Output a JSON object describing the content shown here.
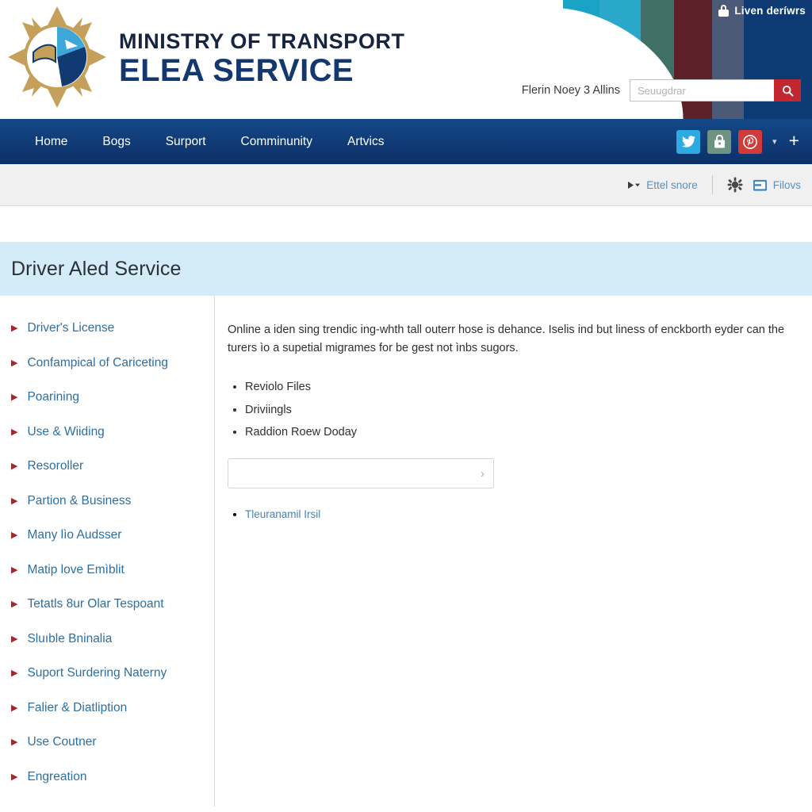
{
  "header": {
    "logo": {
      "crest_icon": "ministry-crest-starburst-icon",
      "line1": "MINISTRY OF TRANSPORT",
      "line2": "ELEA SERVICE"
    },
    "secure_badge": {
      "icon": "lock-icon",
      "text": "Liven deríwrs"
    },
    "search": {
      "label": "Flerin Noey 3 Allins",
      "placeholder": "Seuugdrar",
      "value": "",
      "button_icon": "search-icon",
      "button_color": "#c1272d"
    },
    "arc_band_colors": [
      "#1aa3c4",
      "#2a9ec0",
      "#3f6f66",
      "#5c2128",
      "#4d5a77",
      "#0d3a72"
    ]
  },
  "nav": {
    "background": "#0d3a72",
    "items": [
      {
        "label": "Home"
      },
      {
        "label": "Bogs"
      },
      {
        "label": "Surport"
      },
      {
        "label": "Comminunity"
      },
      {
        "label": "Artvics"
      }
    ],
    "social": [
      {
        "name": "twitter-icon",
        "color": "#2caae1"
      },
      {
        "name": "lock-bag-icon",
        "color": "#6f9383"
      },
      {
        "name": "pinterest-icon",
        "color": "#d33a3a"
      }
    ],
    "caret": "▾",
    "plus": "+"
  },
  "subbar": {
    "left_group": {
      "icon": "play-dropdown-icon",
      "label": "Ettel snore"
    },
    "settings_icon": "gear-icon",
    "right_group": {
      "icon": "folder-icon",
      "label": "Filovs"
    }
  },
  "page": {
    "title": "Driver Aled Service",
    "title_band_color": "#d4ecf7"
  },
  "sidebar": {
    "items": [
      {
        "label": "Driver's License"
      },
      {
        "label": "Confampical of Cariceting"
      },
      {
        "label": "Poarining"
      },
      {
        "label": "Use & Wiiding"
      },
      {
        "label": "Resoroller"
      },
      {
        "label": "Partion & Business"
      },
      {
        "label": "Many lìo Audsser"
      },
      {
        "label": "Matip love Emìblit"
      },
      {
        "label": "Tetatls 8ur Olar Tespoant"
      },
      {
        "label": "Sluıble Bninalia"
      },
      {
        "label": "Suport Surdering Naterny"
      },
      {
        "label": "Falier & Diatliption"
      },
      {
        "label": "Use Coutner"
      },
      {
        "label": "Engreation"
      }
    ],
    "arrow_glyph": "▶",
    "arrow_color": "#a3272e",
    "link_color": "#2d6fa3"
  },
  "main": {
    "intro": "Online a iden sing trendic ing-whth tall outerr hose is dehance.  Iselis ind but liness of enckborth eyder can the turers ìo a supetial migrames for be gest not ìnbs sugors.",
    "bullets": [
      "Reviolo Files",
      "Driviingls",
      "Raddion Roew Doday"
    ],
    "picker": {
      "value": "",
      "chevron": "›"
    },
    "links": [
      {
        "label": "Tleuranamil Irsil"
      }
    ]
  }
}
